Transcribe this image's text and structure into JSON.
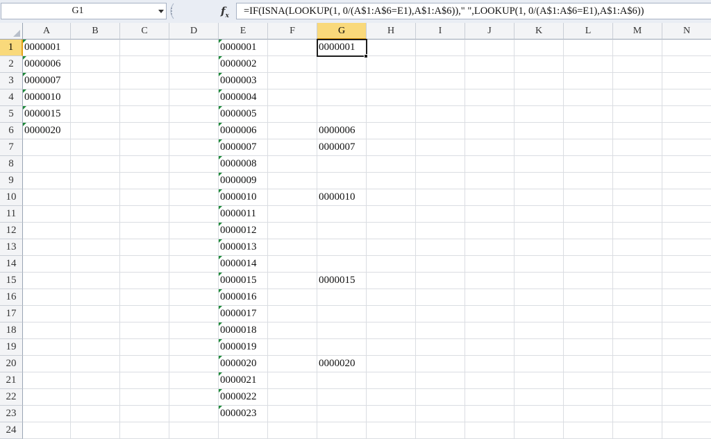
{
  "name_box": "G1",
  "formula": "=IF(ISNA(LOOKUP(1, 0/(A$1:A$6=E1),A$1:A$6)),\" \",LOOKUP(1, 0/(A$1:A$6=E1),A$1:A$6))",
  "fx_icon": "fx-icon",
  "columns": [
    "A",
    "B",
    "C",
    "D",
    "E",
    "F",
    "G",
    "H",
    "I",
    "J",
    "K",
    "L",
    "M",
    "N"
  ],
  "selected_column": "G",
  "rows": [
    "1",
    "2",
    "3",
    "4",
    "5",
    "6",
    "7",
    "8",
    "9",
    "10",
    "11",
    "12",
    "13",
    "14",
    "15",
    "16",
    "17",
    "18",
    "19",
    "20",
    "21",
    "22",
    "23",
    "24"
  ],
  "selected_row": "1",
  "cells": {
    "A": [
      "0000001",
      "0000006",
      "0000007",
      "0000010",
      "0000015",
      "0000020"
    ],
    "E": [
      "0000001",
      "0000002",
      "0000003",
      "0000004",
      "0000005",
      "0000006",
      "0000007",
      "0000008",
      "0000009",
      "0000010",
      "0000011",
      "0000012",
      "0000013",
      "0000014",
      "0000015",
      "0000016",
      "0000017",
      "0000018",
      "0000019",
      "0000020",
      "0000021",
      "0000022",
      "0000023"
    ],
    "G": [
      "0000001",
      "",
      "",
      "",
      "",
      "0000006",
      "0000007",
      "",
      "",
      "0000010",
      "",
      "",
      "",
      "",
      "0000015",
      "",
      "",
      "",
      "",
      "0000020"
    ]
  },
  "text_indicator_color": "#1f8a3a",
  "selection_header_color": "#f9d97b"
}
